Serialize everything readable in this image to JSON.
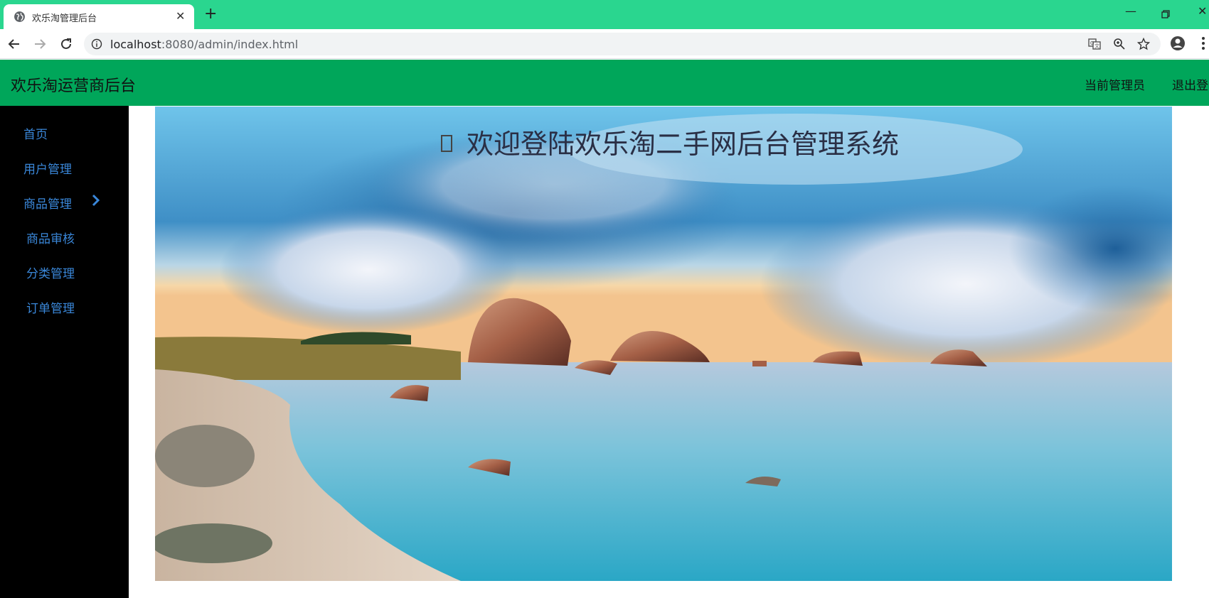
{
  "browser": {
    "tab_title": "欢乐淘管理后台",
    "url_host": "localhost",
    "url_rest": ":8080/admin/index.html"
  },
  "header": {
    "brand": "欢乐淘运营商后台",
    "current_admin": "当前管理员",
    "logout": "退出登"
  },
  "sidebar": {
    "items": [
      {
        "label": "首页"
      },
      {
        "label": "用户管理"
      },
      {
        "label": "商品管理"
      },
      {
        "label": "商品审核"
      },
      {
        "label": "分类管理"
      },
      {
        "label": "订单管理"
      }
    ]
  },
  "main": {
    "welcome": "欢迎登陆欢乐淘二手网后台管理系统"
  },
  "colors": {
    "tabbar": "#2ad68f",
    "header": "#00a65a",
    "sidebar": "#000000",
    "sidebar_link": "#3a87d9"
  }
}
